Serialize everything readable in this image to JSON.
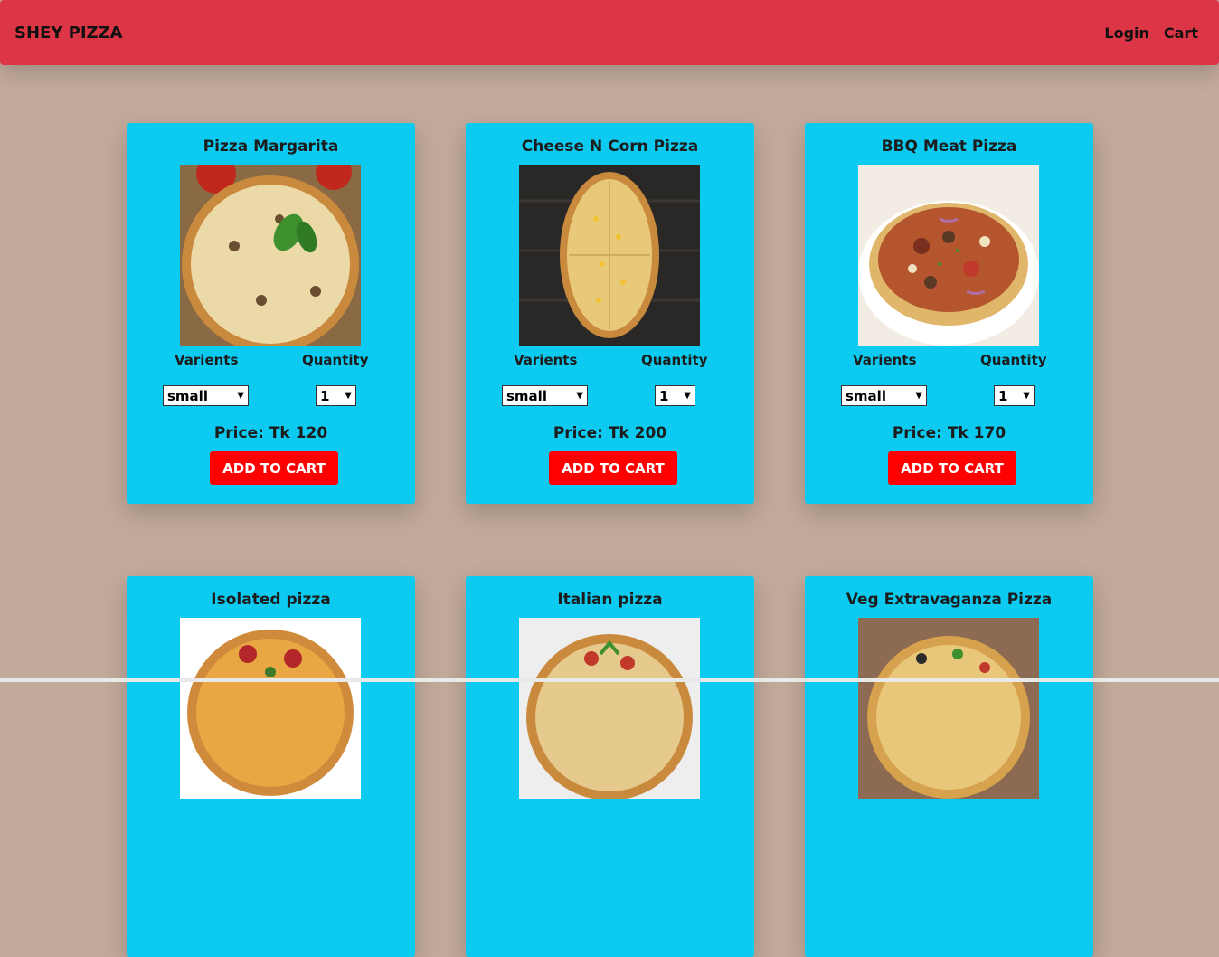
{
  "navbar": {
    "brand": "SHEY PIZZA",
    "links": [
      "Login",
      "Cart"
    ],
    "color": "#dc3545"
  },
  "card_labels": {
    "variants": "Varients",
    "quantity": "Quantity",
    "add_to_cart": "ADD TO CART"
  },
  "pizzas": [
    {
      "name": "Pizza Margarita",
      "variant": "small",
      "quantity": "1",
      "price": "Price: Tk 120"
    },
    {
      "name": "Cheese N Corn Pizza",
      "variant": "small",
      "quantity": "1",
      "price": "Price: Tk 200"
    },
    {
      "name": "BBQ Meat Pizza",
      "variant": "small",
      "quantity": "1",
      "price": "Price: Tk 170"
    },
    {
      "name": "Isolated pizza"
    },
    {
      "name": "Italian pizza"
    },
    {
      "name": "Veg Extravaganza Pizza"
    }
  ],
  "colors": {
    "background": "#c2aa9b",
    "card": "#0dcaf0",
    "button": "#ff0000"
  }
}
